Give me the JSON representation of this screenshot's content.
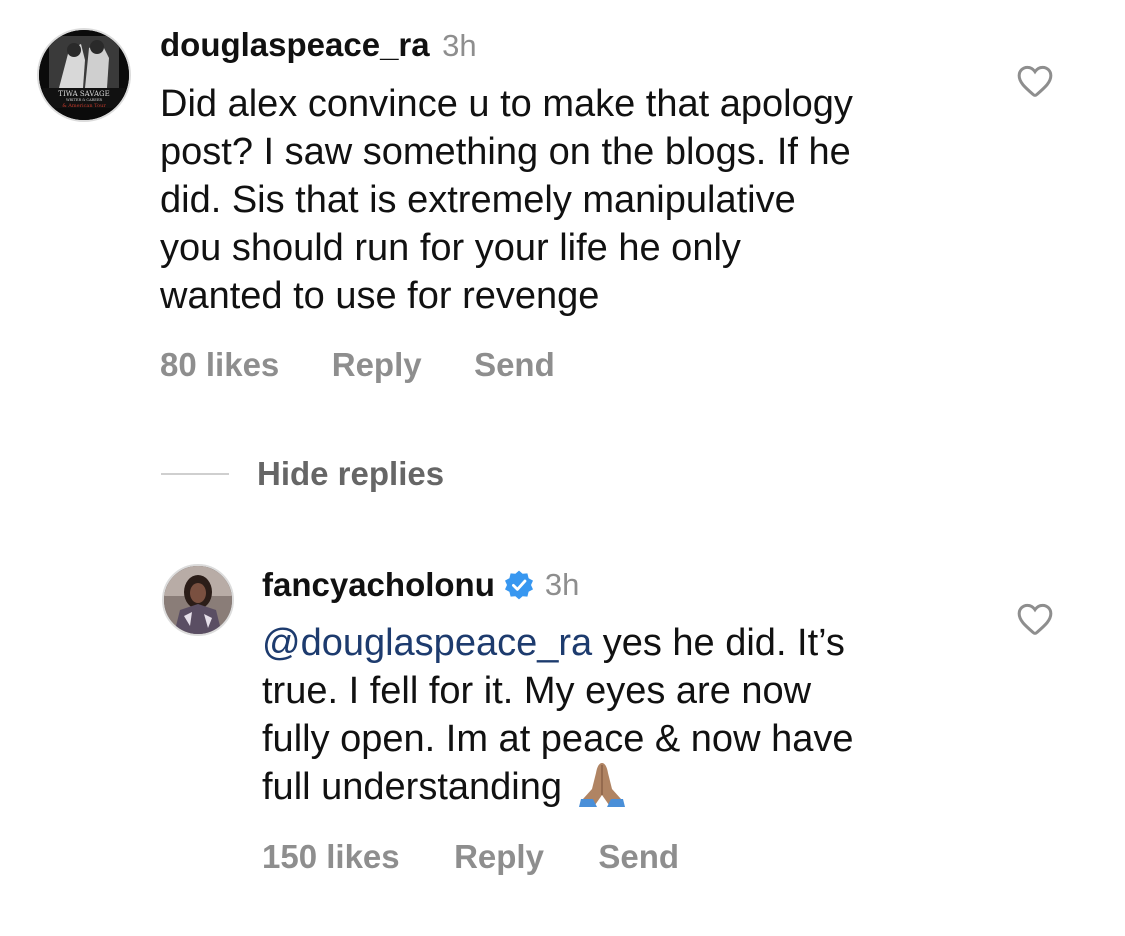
{
  "comments": [
    {
      "username": "douglaspeace_ra",
      "time": "3h",
      "lines": [
        "Did alex convince u to make that apology",
        "post? I saw something on the blogs. If he",
        "did. Sis that is extremely manipulative",
        "you should run for your life he only",
        "wanted to use for revenge"
      ],
      "likes": "80 likes",
      "reply_label": "Reply",
      "send_label": "Send",
      "avatar_text": [
        "TIWA SAVAGE",
        "WRITER & CAREER",
        "& American Tour"
      ]
    }
  ],
  "hide_replies_label": "Hide replies",
  "reply": {
    "username": "fancyacholonu",
    "verified": true,
    "time": "3h",
    "mention": "@douglaspeace_ra",
    "line1_rest": " yes he did. It’s",
    "lines": [
      "true. I fell for it. My eyes are now",
      "fully open. Im at peace & now have"
    ],
    "last_line": "full understanding ",
    "emoji": "🙏🏽",
    "likes": "150 likes",
    "reply_label": "Reply",
    "send_label": "Send"
  },
  "colors": {
    "verified_badge": "#3897f0",
    "mention": "#1d3b6e",
    "meta_gray": "#8e8e8e"
  }
}
